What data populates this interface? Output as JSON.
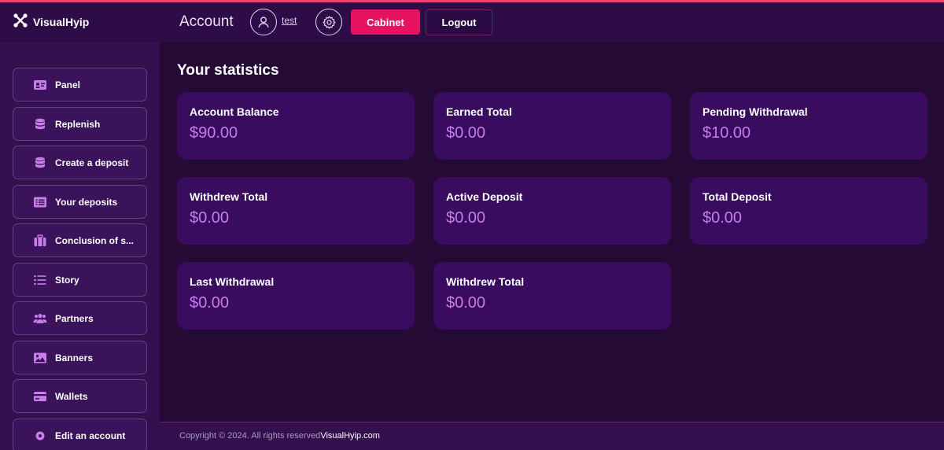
{
  "header": {
    "logo_text": "VisualHyip",
    "title": "Account",
    "username": "test",
    "cabinet_label": "Cabinet",
    "logout_label": "Logout"
  },
  "sidebar": {
    "items": [
      {
        "label": "Panel",
        "icon": "id-card-icon"
      },
      {
        "label": "Replenish",
        "icon": "database-icon"
      },
      {
        "label": "Create a deposit",
        "icon": "database-icon"
      },
      {
        "label": "Your deposits",
        "icon": "list-card-icon"
      },
      {
        "label": "Conclusion of s...",
        "icon": "suitcase-icon"
      },
      {
        "label": "Story",
        "icon": "list-icon"
      },
      {
        "label": "Partners",
        "icon": "users-icon"
      },
      {
        "label": "Banners",
        "icon": "image-icon"
      },
      {
        "label": "Wallets",
        "icon": "credit-card-icon"
      },
      {
        "label": "Edit an account",
        "icon": "user-gear-icon"
      }
    ]
  },
  "main": {
    "title": "Your statistics",
    "cards": [
      {
        "label": "Account Balance",
        "value": "$90.00"
      },
      {
        "label": "Earned Total",
        "value": "$0.00"
      },
      {
        "label": "Pending Withdrawal",
        "value": "$10.00"
      },
      {
        "label": "Withdrew Total",
        "value": "$0.00"
      },
      {
        "label": "Active Deposit",
        "value": "$0.00"
      },
      {
        "label": "Total Deposit",
        "value": "$0.00"
      },
      {
        "label": "Last Withdrawal",
        "value": "$0.00"
      },
      {
        "label": "Withdrew Total",
        "value": "$0.00"
      }
    ]
  },
  "footer": {
    "copyright": "Copyright © 2024. All rights reserved",
    "brand": "VisualHyip.com"
  },
  "colors": {
    "accent_pink": "#e7135f",
    "value_purple": "#c77dea",
    "card_bg": "#3a0c60",
    "sidebar_bg": "#34104f",
    "main_bg": "#250a36"
  }
}
